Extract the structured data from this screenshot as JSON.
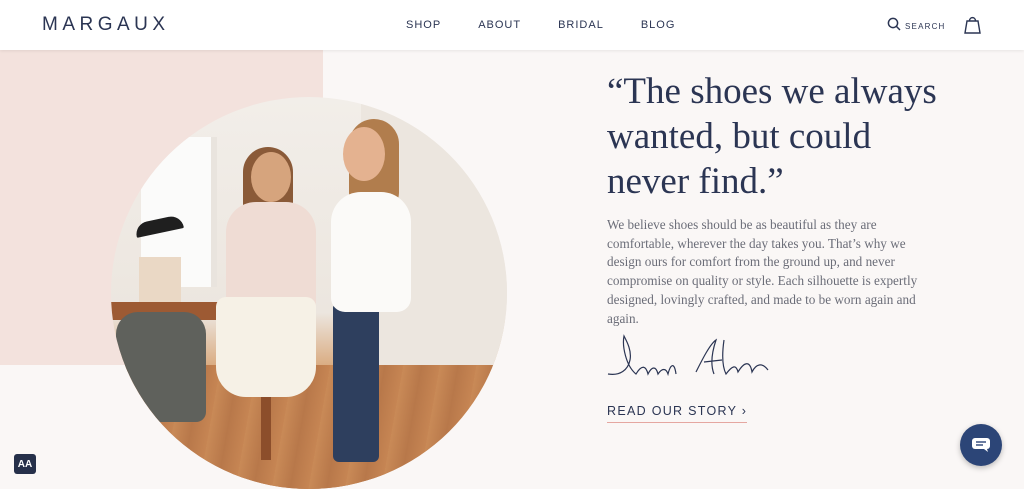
{
  "brand": {
    "logo_text": "MARGAUX"
  },
  "nav": {
    "items": [
      "SHOP",
      "ABOUT",
      "BRIDAL",
      "BLOG"
    ]
  },
  "header": {
    "search_label": "SEARCH"
  },
  "hero": {
    "quote": "“The shoes we always wanted, but could never find.”",
    "body": "We believe shoes should be as beautiful as they are comfortable, wherever the day takes you. That’s why we design ours for comfort from the ground up, and never compromise on quality or style. Each silhouette is expertly designed, lovingly crafted, and made to be worn again and again.",
    "signature_names": [
      "Sarah",
      "Alexa"
    ],
    "cta_label": "READ OUR STORY ›"
  },
  "widgets": {
    "accessibility_label": "AA"
  },
  "colors": {
    "navy": "#2b3553",
    "pink_panel": "#f3e2dd",
    "cta_underline": "#e5a7a1",
    "chat_bg": "#2c4577"
  },
  "icons": {
    "search": "search-icon",
    "bag": "shopping-bag-icon",
    "chat": "chat-icon"
  }
}
